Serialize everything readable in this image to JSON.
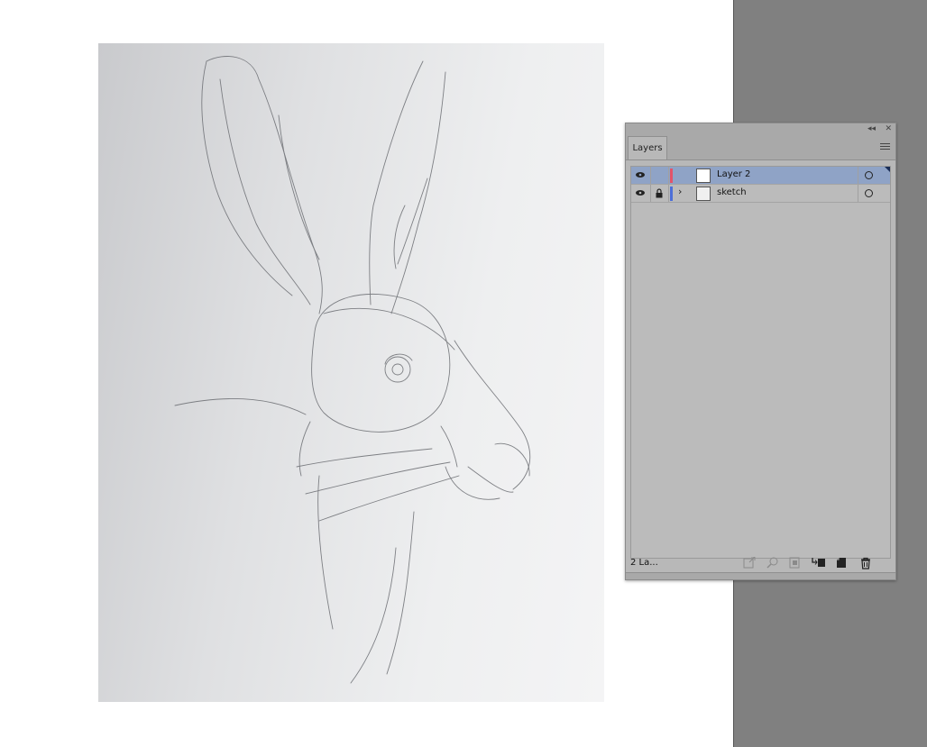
{
  "panel": {
    "tab_label": "Layers",
    "collapse_glyph": "◂◂",
    "close_glyph": "✕",
    "layer_count": "2 La..."
  },
  "layers": [
    {
      "name": "Layer 2",
      "color": "#e3546a",
      "selected": true,
      "locked": false,
      "expandable": false
    },
    {
      "name": "sketch",
      "color": "#4d6fd8",
      "selected": false,
      "locked": true,
      "expandable": true
    }
  ],
  "footer_icons": [
    "export-icon",
    "locate-object-icon",
    "make-clipping-mask-icon",
    "create-sublayer-icon",
    "new-layer-icon",
    "delete-icon"
  ],
  "colors": {
    "selection": "#8fa3c6",
    "panel_bg": "#b8b8b8",
    "pasteboard": "#808080"
  }
}
